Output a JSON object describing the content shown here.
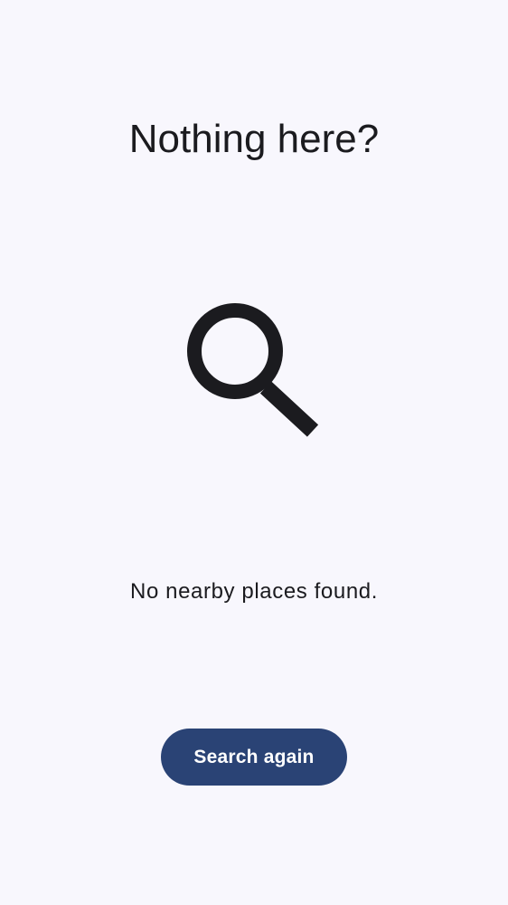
{
  "header": {
    "title": "Nothing here?"
  },
  "illustration": {
    "icon": "search-icon",
    "color": "#1b1b1f"
  },
  "message": {
    "text": "No nearby places found."
  },
  "actions": {
    "search_again_label": "Search again",
    "button_color": "#2a4375"
  },
  "theme": {
    "background": "#f8f7fd",
    "text": "#1b1b1f"
  }
}
